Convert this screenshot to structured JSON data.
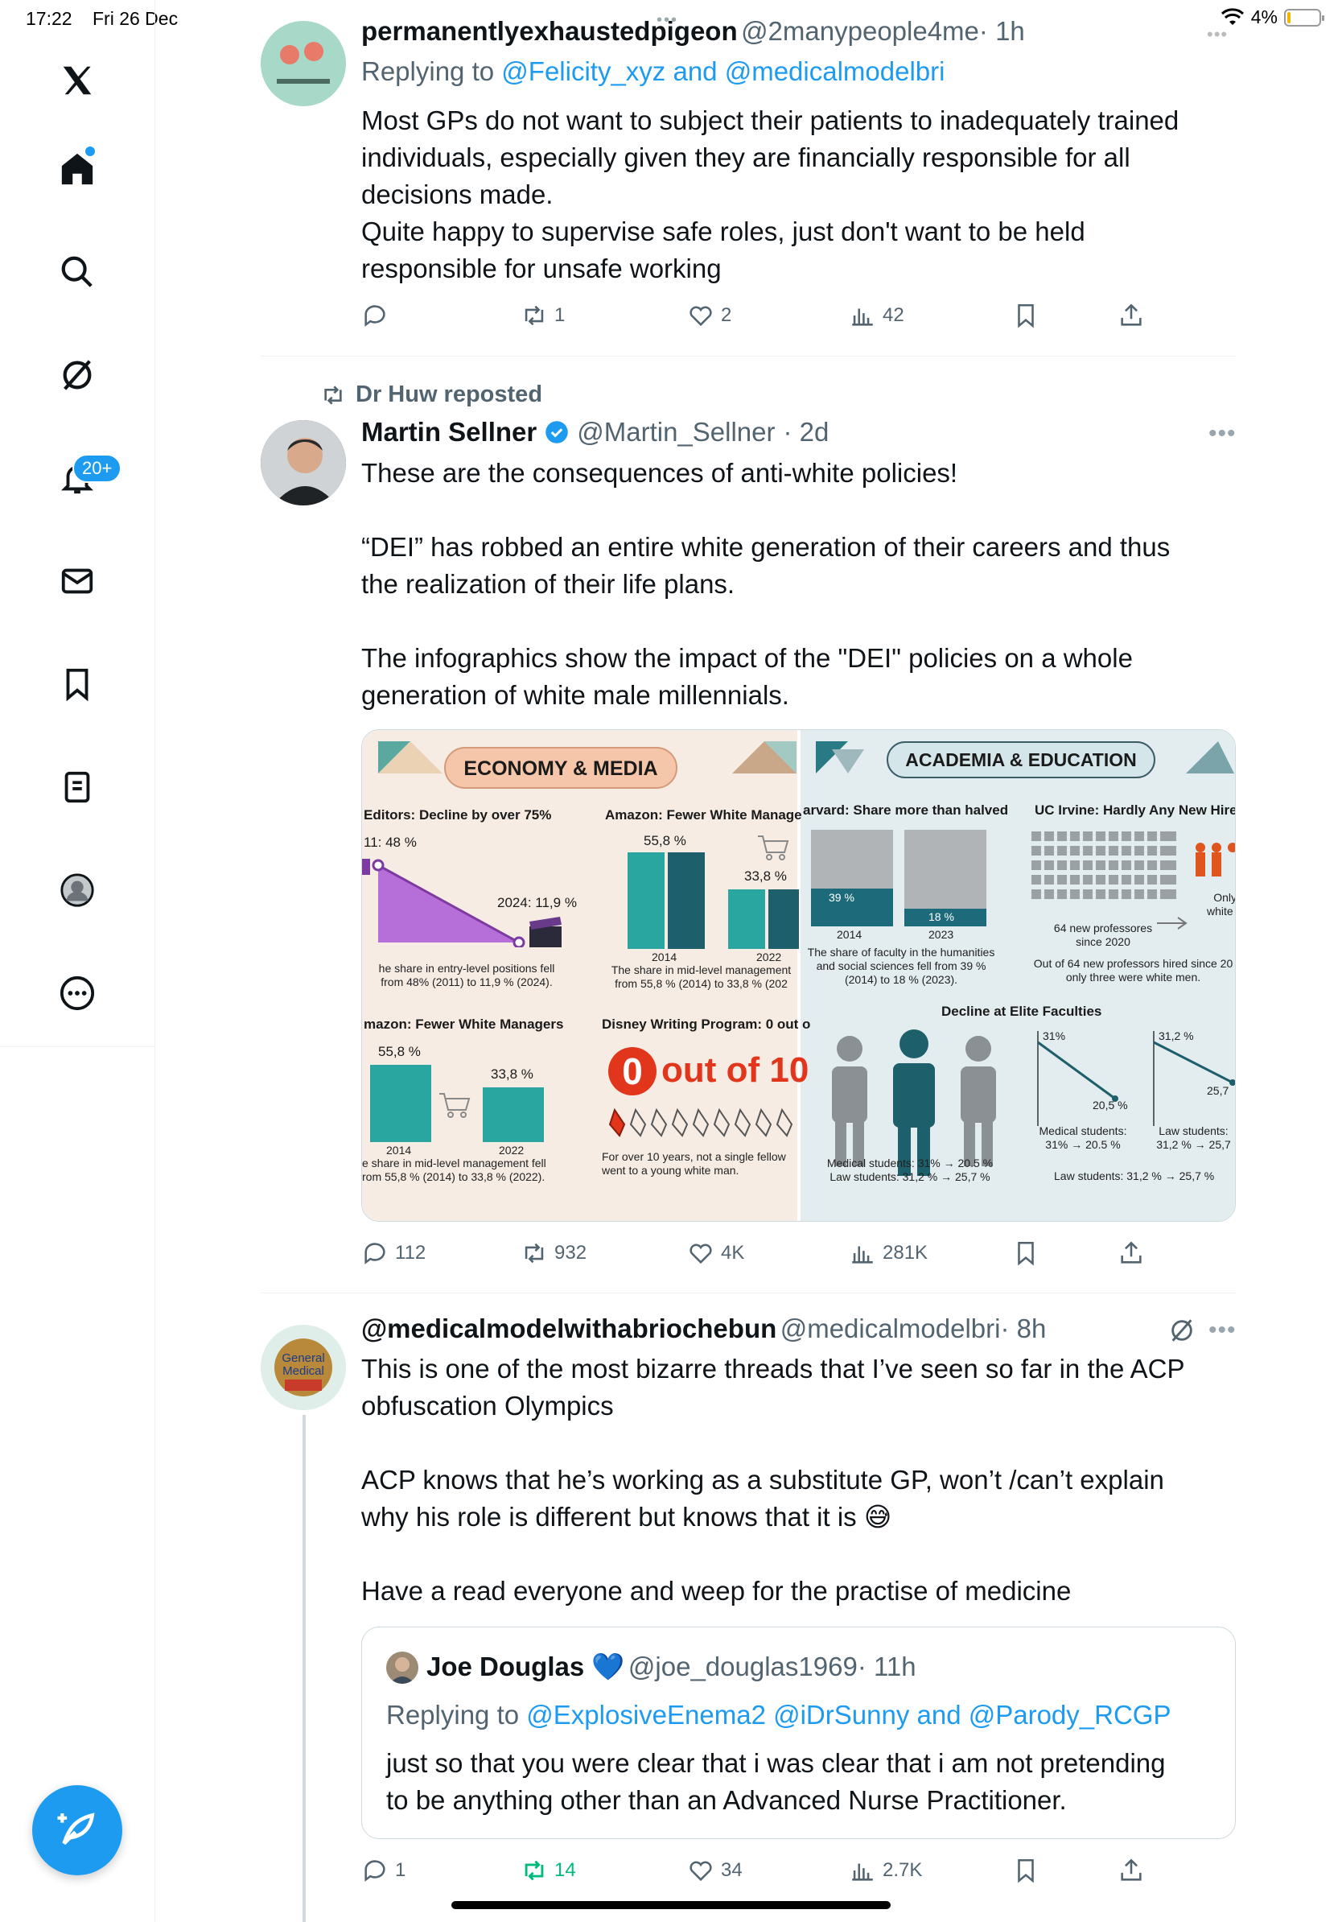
{
  "status": {
    "time": "17:22",
    "date": "Fri 26 Dec",
    "battery": "4%"
  },
  "sidebar": {
    "notifications_badge": "20+"
  },
  "tweet1": {
    "name": "permanentlyexhaustedpigeon",
    "handle": "@2manypeople4me",
    "time": "· 1h",
    "reply_prefix": "Replying to",
    "reply_to": "@Felicity_xyz and @medicalmodelbri",
    "text_lines": [
      "Most GPs do not want to subject their patients to inadequately trained",
      "individuals, especially given they are financially responsible for all",
      "decisions made.",
      "Quite happy to supervise safe roles, just don't want to be held",
      "responsible for unsafe working"
    ],
    "replies": "",
    "reposts": "1",
    "likes": "2",
    "views": "42"
  },
  "tweet2": {
    "reposted_by": "Dr Huw reposted",
    "name": "Martin Sellner",
    "handle": "@Martin_Sellner",
    "time": "· 2d",
    "text_lines": [
      "These are the consequences of anti-white policies!",
      "",
      "“DEI” has robbed an entire white generation of their careers and thus",
      "the realization of their life plans.",
      "",
      "The infographics show the impact of the \"DEI\" policies on a whole",
      "generation of white male millennials."
    ],
    "replies": "112",
    "reposts": "932",
    "likes": "4K",
    "views": "281K",
    "infographic": {
      "left_title": "ECONOMY & MEDIA",
      "right_title": "ACADEMIA & EDUCATION",
      "editors_title": "Editors: Decline by over 75%",
      "editors_start": "11: 48 %",
      "editors_end": "2024: 11,9 %",
      "editors_caption1": "he share in entry-level positions fell",
      "editors_caption2": "from 48% (2011) to 11,9 % (2024).",
      "amazon1_title": "Amazon: Fewer White Manage",
      "amazon1_v1": "55,8 %",
      "amazon1_v2": "33,8 %",
      "amazon1_y1": "2014",
      "amazon1_y2": "2022",
      "amazon1_caption1": "The share in mid-level management",
      "amazon1_caption2": "from 55,8 % (2014) to 33,8 % (202",
      "amazon2_title": "mazon: Fewer White Managers",
      "amazon2_v1": "55,8 %",
      "amazon2_v2": "33,8 %",
      "amazon2_y1": "2014",
      "amazon2_y2": "2022",
      "amazon2_caption1": "e share in mid-level management fell",
      "amazon2_caption2": "rom 55,8 % (2014) to 33,8 % (2022).",
      "disney_title": "Disney Writing Program: 0 out o",
      "disney_zero": "0",
      "disney_outof": "out of 10",
      "disney_caption1": "For over 10 years, not a single fellow",
      "disney_caption2": "went to a young white man.",
      "harvard_title": "arvard: Share more than halved",
      "harvard_v1": "39 %",
      "harvard_v2": "18 %",
      "harvard_y1": "2014",
      "harvard_y2": "2023",
      "harvard_caption1": "The share of faculty in the humanities",
      "harvard_caption2": "and social sciences fell from 39 %",
      "harvard_caption3": "(2014) to 18 % (2023).",
      "ucirvine_title": "UC Irvine: Hardly Any New Hires",
      "ucirvine_new": "64 new professores",
      "ucirvine_since": "since 2020",
      "ucirvine_only1": "Only",
      "ucirvine_only2": "white r",
      "ucirvine_caption1": "Out of 64 new professors hired since 20",
      "ucirvine_caption2": "only three were white men.",
      "elite_title": "Decline at Elite Faculties",
      "elite_med_start": "31%",
      "elite_med_end": "20,5 %",
      "elite_law_start": "31,2 %",
      "elite_law_end": "25,7",
      "elite_med_label": "Medical students:",
      "elite_med_change": "31% → 20.5 %",
      "elite_law_label": "Law students:",
      "elite_law_change": "31,2 % → 25,7",
      "elite_law_summary": "Law students: 31,2 % → 25,7 %",
      "people_med": "Medical students: 31% → 20.5 %",
      "people_law": "Law students: 31,2 % → 25,7 %"
    }
  },
  "tweet3": {
    "name": "@medicalmodelwithabriochebun",
    "handle": "@medicalmodelbri",
    "time": "· 8h",
    "text_lines": [
      "This is one of the most bizarre threads that I’ve seen so far in the ACP",
      "obfuscation Olympics",
      "",
      "ACP knows that he’s working as a substitute GP, won’t /can’t explain",
      "why his role is different but knows that it is 😅",
      "",
      "Have a read everyone and weep for the practise of medicine"
    ],
    "replies": "1",
    "reposts": "14",
    "likes": "34",
    "views": "2.7K",
    "quote": {
      "name": "Joe Douglas 💙",
      "handle": "@joe_douglas1969",
      "time": "· 11h",
      "reply_prefix": "Replying to",
      "reply_to": "@ExplosiveEnema2 @iDrSunny and @Parody_RCGP",
      "text_lines": [
        "just so that you were clear that i was clear that i am not pretending",
        "to be anything other than an Advanced Nurse Practitioner."
      ]
    }
  },
  "colors": {
    "accent": "#1d9bf0",
    "muted": "#536471",
    "repost_green": "#00ba7c"
  }
}
